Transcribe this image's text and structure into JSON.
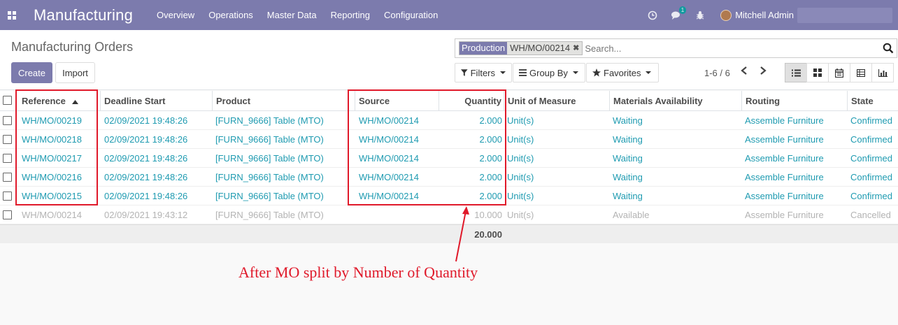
{
  "navbar": {
    "brand": "Manufacturing",
    "menu": [
      "Overview",
      "Operations",
      "Master Data",
      "Reporting",
      "Configuration"
    ],
    "chat_badge": "1",
    "user_name": "Mitchell Admin"
  },
  "control": {
    "title": "Manufacturing Orders",
    "create_label": "Create",
    "import_label": "Import",
    "facet_category": "Production",
    "facet_value": "WH/MO/00214",
    "search_placeholder": "Search...",
    "filters_label": "Filters",
    "groupby_label": "Group By",
    "favorites_label": "Favorites",
    "pager": "1-6 / 6"
  },
  "table": {
    "columns": [
      "Reference",
      "Deadline Start",
      "Product",
      "Source",
      "Quantity",
      "Unit of Measure",
      "Materials Availability",
      "Routing",
      "State"
    ],
    "rows": [
      {
        "reference": "WH/MO/00219",
        "deadline": "02/09/2021 19:48:26",
        "product": "[FURN_9666] Table (MTO)",
        "source": "WH/MO/00214",
        "quantity": "2.000",
        "uom": "Unit(s)",
        "availability": "Waiting",
        "routing": "Assemble Furniture",
        "state": "Confirmed",
        "muted": false
      },
      {
        "reference": "WH/MO/00218",
        "deadline": "02/09/2021 19:48:26",
        "product": "[FURN_9666] Table (MTO)",
        "source": "WH/MO/00214",
        "quantity": "2.000",
        "uom": "Unit(s)",
        "availability": "Waiting",
        "routing": "Assemble Furniture",
        "state": "Confirmed",
        "muted": false
      },
      {
        "reference": "WH/MO/00217",
        "deadline": "02/09/2021 19:48:26",
        "product": "[FURN_9666] Table (MTO)",
        "source": "WH/MO/00214",
        "quantity": "2.000",
        "uom": "Unit(s)",
        "availability": "Waiting",
        "routing": "Assemble Furniture",
        "state": "Confirmed",
        "muted": false
      },
      {
        "reference": "WH/MO/00216",
        "deadline": "02/09/2021 19:48:26",
        "product": "[FURN_9666] Table (MTO)",
        "source": "WH/MO/00214",
        "quantity": "2.000",
        "uom": "Unit(s)",
        "availability": "Waiting",
        "routing": "Assemble Furniture",
        "state": "Confirmed",
        "muted": false
      },
      {
        "reference": "WH/MO/00215",
        "deadline": "02/09/2021 19:48:26",
        "product": "[FURN_9666] Table (MTO)",
        "source": "WH/MO/00214",
        "quantity": "2.000",
        "uom": "Unit(s)",
        "availability": "Waiting",
        "routing": "Assemble Furniture",
        "state": "Confirmed",
        "muted": false
      },
      {
        "reference": "WH/MO/00214",
        "deadline": "02/09/2021 19:43:12",
        "product": "[FURN_9666] Table (MTO)",
        "source": "",
        "quantity": "10.000",
        "uom": "Unit(s)",
        "availability": "Available",
        "routing": "Assemble Furniture",
        "state": "Cancelled",
        "muted": true
      }
    ],
    "total_quantity": "20.000"
  },
  "annotation": "After MO split by Number of Quantity",
  "colors": {
    "brand": "#7c7bad",
    "link": "#1f9bb1",
    "annotation": "#e0192a"
  }
}
